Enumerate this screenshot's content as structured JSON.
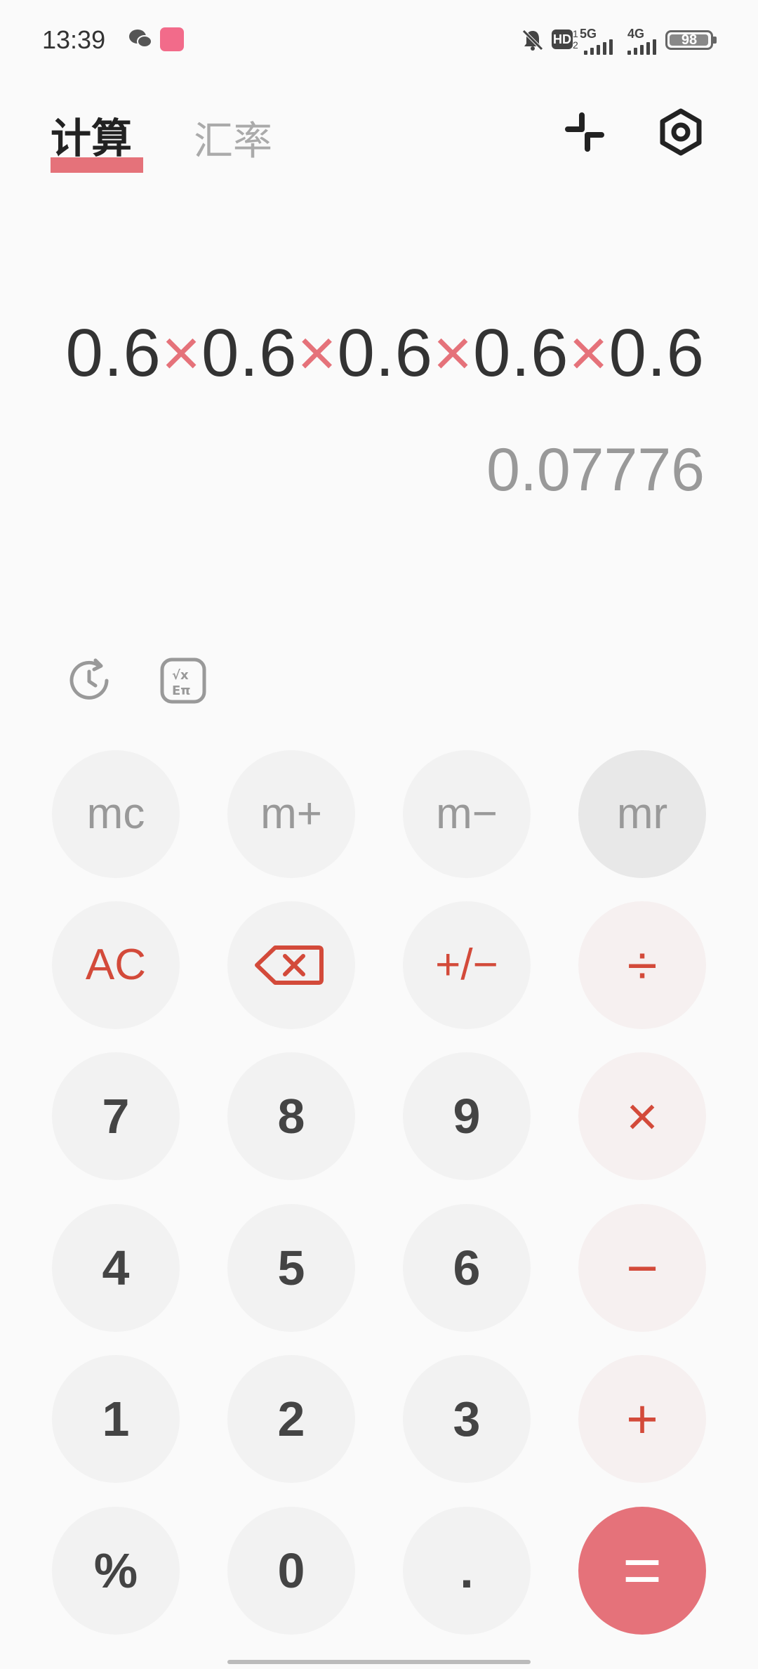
{
  "status_bar": {
    "time": "13:39",
    "hd_sub": "1\n2",
    "net_5g": "5G",
    "net_4g": "4G",
    "battery": "98",
    "battery_level": 0.98
  },
  "header": {
    "tab_calc": "计算",
    "tab_rate": "汇率",
    "accent": "#e5727a"
  },
  "display": {
    "expression": [
      {
        "t": "0.6",
        "op": false
      },
      {
        "t": "×",
        "op": true
      },
      {
        "t": "0.6",
        "op": false
      },
      {
        "t": "×",
        "op": true
      },
      {
        "t": "0.6",
        "op": false
      },
      {
        "t": "×",
        "op": true
      },
      {
        "t": "0.6",
        "op": false
      },
      {
        "t": "×",
        "op": true
      },
      {
        "t": "0.6",
        "op": false
      }
    ],
    "result": "0.07776"
  },
  "tools": {
    "history_icon": "history-icon",
    "scientific_icon": "scientific-icon"
  },
  "keys": {
    "mc": "mc",
    "mplus": "m+",
    "mminus": "m−",
    "mr": "mr",
    "ac": "AC",
    "backspace_icon": "backspace-icon",
    "sign": "+/−",
    "divide": "÷",
    "k7": "7",
    "k8": "8",
    "k9": "9",
    "multiply": "×",
    "k4": "4",
    "k5": "5",
    "k6": "6",
    "minus": "−",
    "k1": "1",
    "k2": "2",
    "k3": "3",
    "plus": "+",
    "percent": "%",
    "k0": "0",
    "dot": ".",
    "equals": "="
  }
}
